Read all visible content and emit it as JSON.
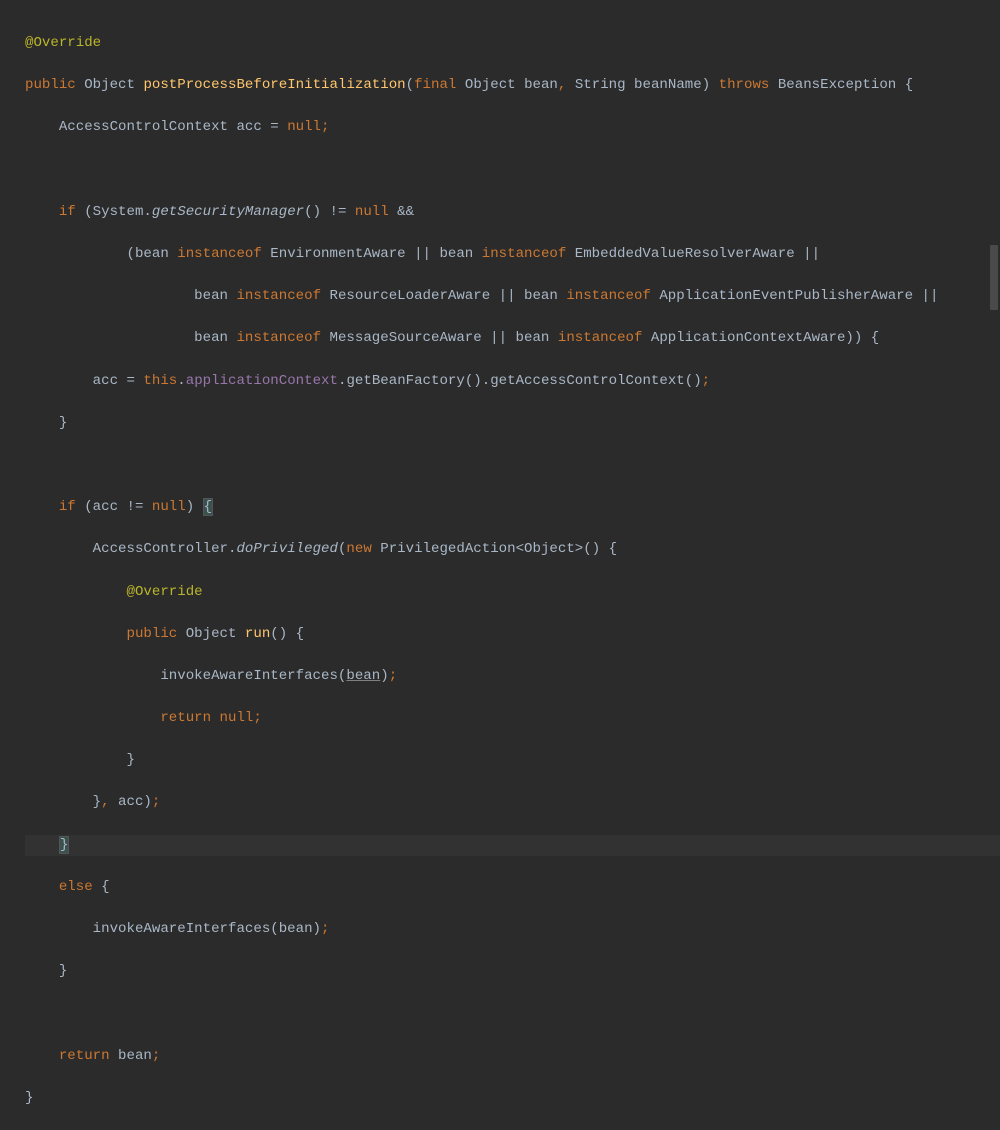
{
  "colors": {
    "background": "#2b2b2b",
    "text": "#a9b7c6",
    "annotation": "#bbb529",
    "keyword": "#cc7832",
    "method": "#ffc66d",
    "field": "#9876aa",
    "currentLine": "#323232",
    "braceMatch": "#3b514d"
  },
  "code": {
    "l1_annotation": "@Override",
    "l2_public": "public",
    "l2_object": "Object",
    "l2_method": "postProcessBeforeInitialization",
    "l2_paren_open": "(",
    "l2_final": "final",
    "l2_param1": "Object bean",
    "l2_comma1": ",",
    "l2_param2": " String beanName",
    "l2_paren_close": ")",
    "l2_throws": "throws",
    "l2_exception": " BeansException {",
    "l3_pre": "    AccessControlContext acc = ",
    "l3_null": "null",
    "l3_semi": ";",
    "l5_if": "    if",
    "l5_pre": " (System.",
    "l5_method": "getSecurityManager",
    "l5_post": "() != ",
    "l5_null": "null",
    "l5_and": " &&",
    "l6_pre": "            (bean ",
    "l6_inst1": "instanceof",
    "l6_mid1": " EnvironmentAware || bean ",
    "l6_inst2": "instanceof",
    "l6_mid2": " EmbeddedValueResolverAware ||",
    "l7_pre": "                    bean ",
    "l7_inst1": "instanceof",
    "l7_mid1": " ResourceLoaderAware || bean ",
    "l7_inst2": "instanceof",
    "l7_mid2": " ApplicationEventPublisherAware ||",
    "l8_pre": "                    bean ",
    "l8_inst1": "instanceof",
    "l8_mid1": " MessageSourceAware || bean ",
    "l8_inst2": "instanceof",
    "l8_mid2": " ApplicationContextAware)) {",
    "l9_pre": "        acc = ",
    "l9_this": "this",
    "l9_dot": ".",
    "l9_field": "applicationContext",
    "l9_post": ".getBeanFactory().getAccessControlContext()",
    "l9_semi": ";",
    "l10_close": "    }",
    "l12_if": "    if",
    "l12_pre": " (acc != ",
    "l12_null": "null",
    "l12_post": ") ",
    "l12_brace": "{",
    "l13_pre": "        AccessController.",
    "l13_method": "doPrivileged",
    "l13_paren": "(",
    "l13_new": "new",
    "l13_post": " PrivilegedAction<Object>() {",
    "l14_annotation": "            @Override",
    "l15_pre": "            ",
    "l15_public": "public",
    "l15_obj": " Object ",
    "l15_method": "run",
    "l15_post": "() {",
    "l16_pre": "                invokeAwareInterfaces(",
    "l16_bean": "bean",
    "l16_post": ")",
    "l16_semi": ";",
    "l17_pre": "                ",
    "l17_return": "return",
    "l17_null": " null",
    "l17_semi": ";",
    "l18_close": "            }",
    "l19_pre": "        }",
    "l19_comma": ",",
    "l19_post": " acc)",
    "l19_semi": ";",
    "l20_pre": "    ",
    "l20_brace": "}",
    "l21_pre": "    ",
    "l21_else": "else",
    "l21_post": " {",
    "l22_pre": "        invokeAwareInterfaces(bean)",
    "l22_semi": ";",
    "l23_close": "    }",
    "l25_pre": "    ",
    "l25_return": "return",
    "l25_post": " bean",
    "l25_semi": ";",
    "l26_close": "}"
  }
}
